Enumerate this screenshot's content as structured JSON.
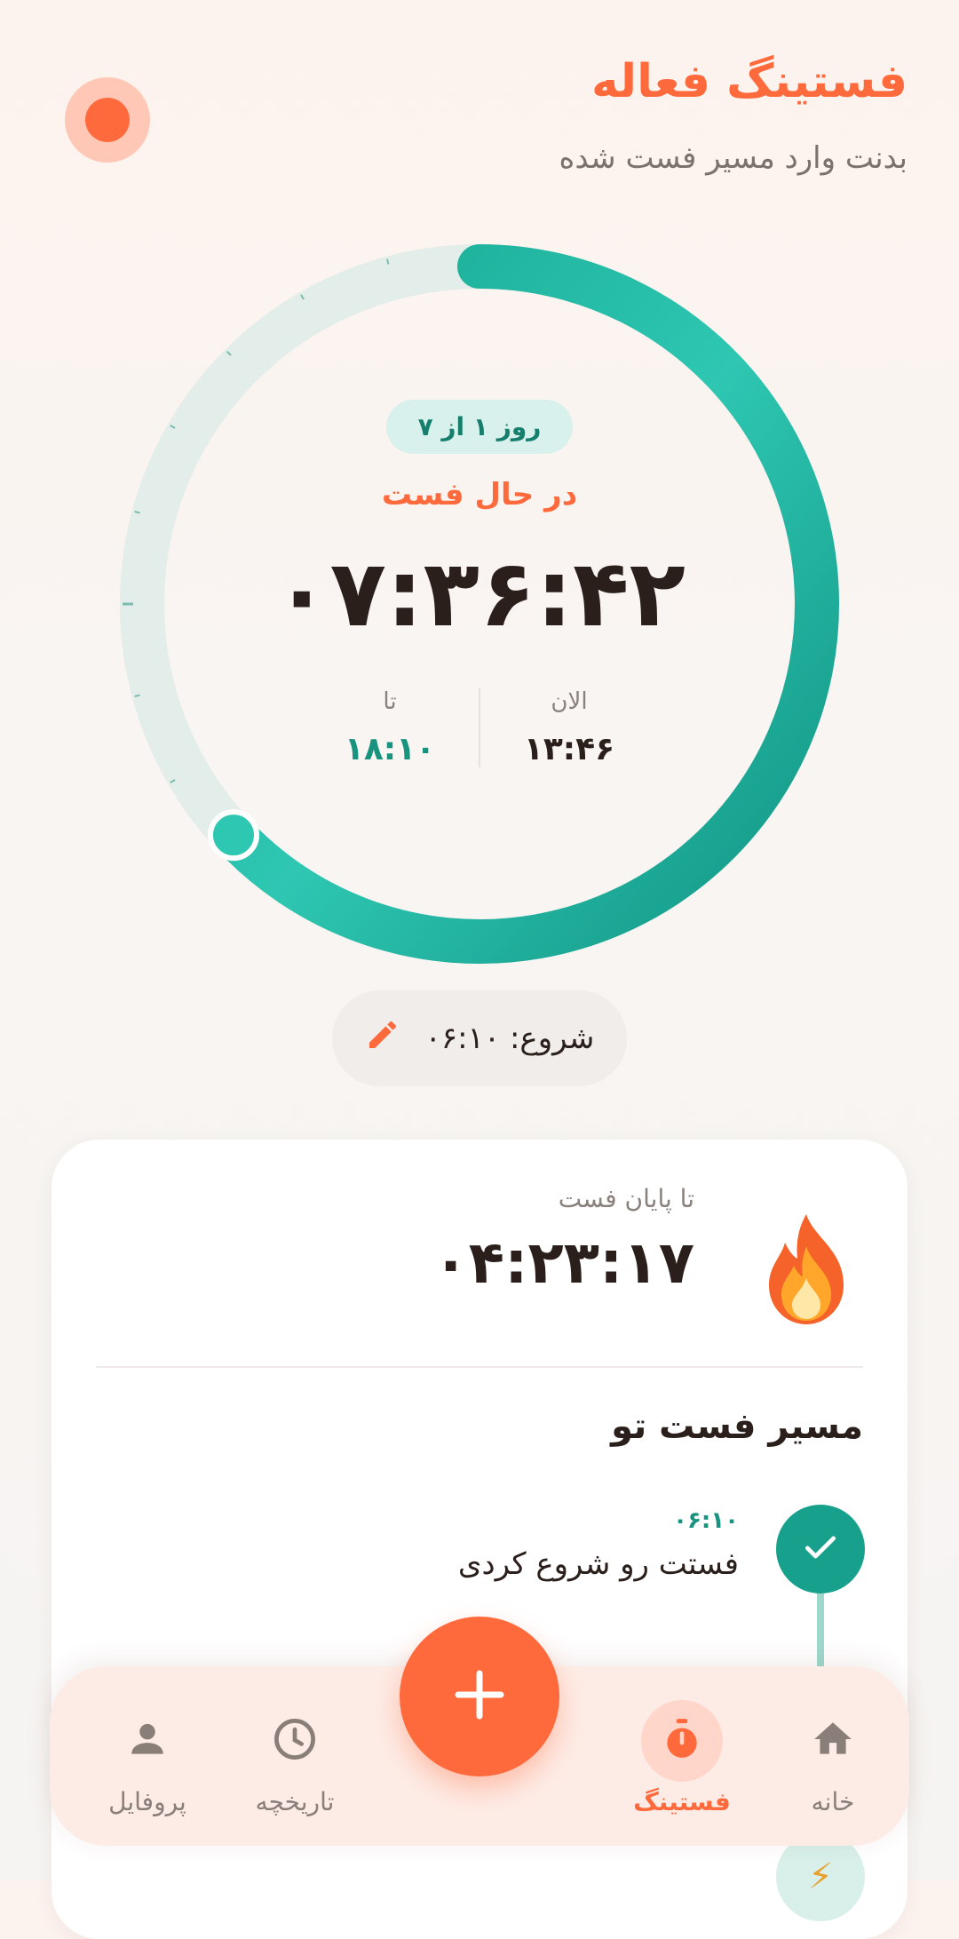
{
  "header": {
    "title": "فستینگ فعاله",
    "subtitle": "بدنت وارد مسیر فست شده"
  },
  "timer": {
    "day_badge": "روز ۱ از ۷",
    "state": "در حال فست",
    "elapsed": "۰۷:۳۶:۴۲",
    "progress_fraction": 0.63,
    "now_label": "الان",
    "now_value": "۱۳:۴۶",
    "until_label": "تا",
    "until_value": "۱۸:۱۰"
  },
  "start": {
    "label": "شروع: ۰۶:۱۰"
  },
  "remaining": {
    "label": "تا پایان فست",
    "value": "۰۴:۲۳:۱۷"
  },
  "path": {
    "title": "مسیر فست تو",
    "steps": [
      {
        "time": "۰۶:۱۰",
        "text": "فستت رو شروع کردی",
        "done": true
      }
    ]
  },
  "nav": {
    "items": [
      {
        "label": "خانه",
        "icon": "home-icon"
      },
      {
        "label": "فستینگ",
        "icon": "stopwatch-icon",
        "active": true
      },
      {
        "label": "تاریخچه",
        "icon": "clock-icon"
      },
      {
        "label": "پروفایل",
        "icon": "person-icon"
      }
    ],
    "fab_icon": "plus-icon"
  },
  "colors": {
    "accent": "#ff6a3d",
    "teal": "#17a08c",
    "teal_light": "#2ec7b2",
    "track": "#e3ede9"
  }
}
